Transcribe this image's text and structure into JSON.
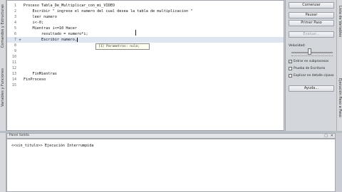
{
  "left_strip": {
    "tab_a": "Comandos y Estructuras",
    "tab_b": "Variables y Funciones"
  },
  "right_strip": {
    "tab_a": "Lista de Variables",
    "tab_b": "Ejecución Paso a Paso"
  },
  "editor": {
    "lines": [
      {
        "n": "1",
        "mark": "",
        "text": "Proceso Tabla_De_Multiplicar_con_mi_VIDEO"
      },
      {
        "n": "2",
        "mark": "",
        "text": "    Escribir \" ingrese el numero del cual desea la tabla de multiplicacion \""
      },
      {
        "n": "3",
        "mark": "",
        "text": "    leer numero"
      },
      {
        "n": "4",
        "mark": "",
        "text": "    i<-0;"
      },
      {
        "n": "5",
        "mark": "",
        "text": "    Mientras i<=10 Hacer"
      },
      {
        "n": "6",
        "mark": "",
        "text": "        resultado = numero*i;"
      },
      {
        "n": "7",
        "mark": "+",
        "text": "        Escribir numero,"
      },
      {
        "n": "8",
        "mark": "",
        "text": ""
      },
      {
        "n": "9",
        "mark": "",
        "text": ""
      },
      {
        "n": "10",
        "mark": "",
        "text": ""
      },
      {
        "n": "11",
        "mark": "",
        "text": ""
      },
      {
        "n": "12",
        "mark": "",
        "text": ""
      },
      {
        "n": "13",
        "mark": "",
        "text": "    FinMientras"
      },
      {
        "n": "14",
        "mark": "",
        "text": "FinProceso"
      },
      {
        "n": "15",
        "mark": "",
        "text": ""
      }
    ],
    "autocomplete_hint": "[1] Parametros: nulo;"
  },
  "run_panel": {
    "comenzar": "Comenzar",
    "pausar": "Pausar",
    "primer_paso": "Primer Paso",
    "evaluar": "Evaluar...",
    "velocidad_label": "Velocidad:",
    "velocidad_value": 0.5,
    "checkboxes": [
      {
        "label": "Entrar en subprocesos",
        "checked": true
      },
      {
        "label": "Prueba de Escritorio",
        "checked": false
      },
      {
        "label": "Explicar en detalle c/paso",
        "checked": false
      }
    ],
    "ayuda": "Ayuda..."
  },
  "output": {
    "title": "Panel Salida",
    "message": "<<sin_titulo>> Ejecución Interrumpida"
  }
}
